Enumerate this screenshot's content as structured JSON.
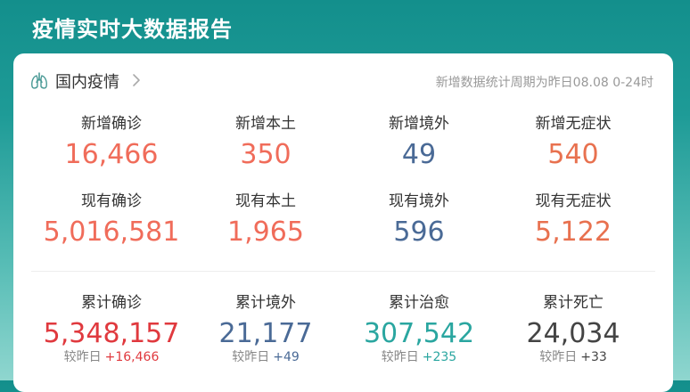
{
  "header": {
    "title": "疫情实时大数据报告"
  },
  "card": {
    "title": "国内疫情",
    "period_note": "新增数据统计周期为昨日08.08 0-24时"
  },
  "row1": [
    {
      "label": "新增确诊",
      "value": "16,466",
      "color": "#f06c5a"
    },
    {
      "label": "新增本土",
      "value": "350",
      "color": "#f06c5a"
    },
    {
      "label": "新增境外",
      "value": "49",
      "color": "#4a6a96"
    },
    {
      "label": "新增无症状",
      "value": "540",
      "color": "#e8714f"
    }
  ],
  "row2": [
    {
      "label": "现有确诊",
      "value": "5,016,581",
      "color": "#f06c5a"
    },
    {
      "label": "现有本土",
      "value": "1,965",
      "color": "#f06c5a"
    },
    {
      "label": "现有境外",
      "value": "596",
      "color": "#4a6a96"
    },
    {
      "label": "现有无症状",
      "value": "5,122",
      "color": "#e8714f"
    }
  ],
  "row3": [
    {
      "label": "累计确诊",
      "value": "5,348,157",
      "color": "#e0393e",
      "delta_label": "较昨日",
      "delta": "+16,466",
      "delta_color": "#e0393e"
    },
    {
      "label": "累计境外",
      "value": "21,177",
      "color": "#4a6a96",
      "delta_label": "较昨日",
      "delta": "+49",
      "delta_color": "#4a6a96"
    },
    {
      "label": "累计治愈",
      "value": "307,542",
      "color": "#2aa6a0",
      "delta_label": "较昨日",
      "delta": "+235",
      "delta_color": "#2aa6a0"
    },
    {
      "label": "累计死亡",
      "value": "24,034",
      "color": "#444444",
      "delta_label": "较昨日",
      "delta": "+33",
      "delta_color": "#444444"
    }
  ]
}
